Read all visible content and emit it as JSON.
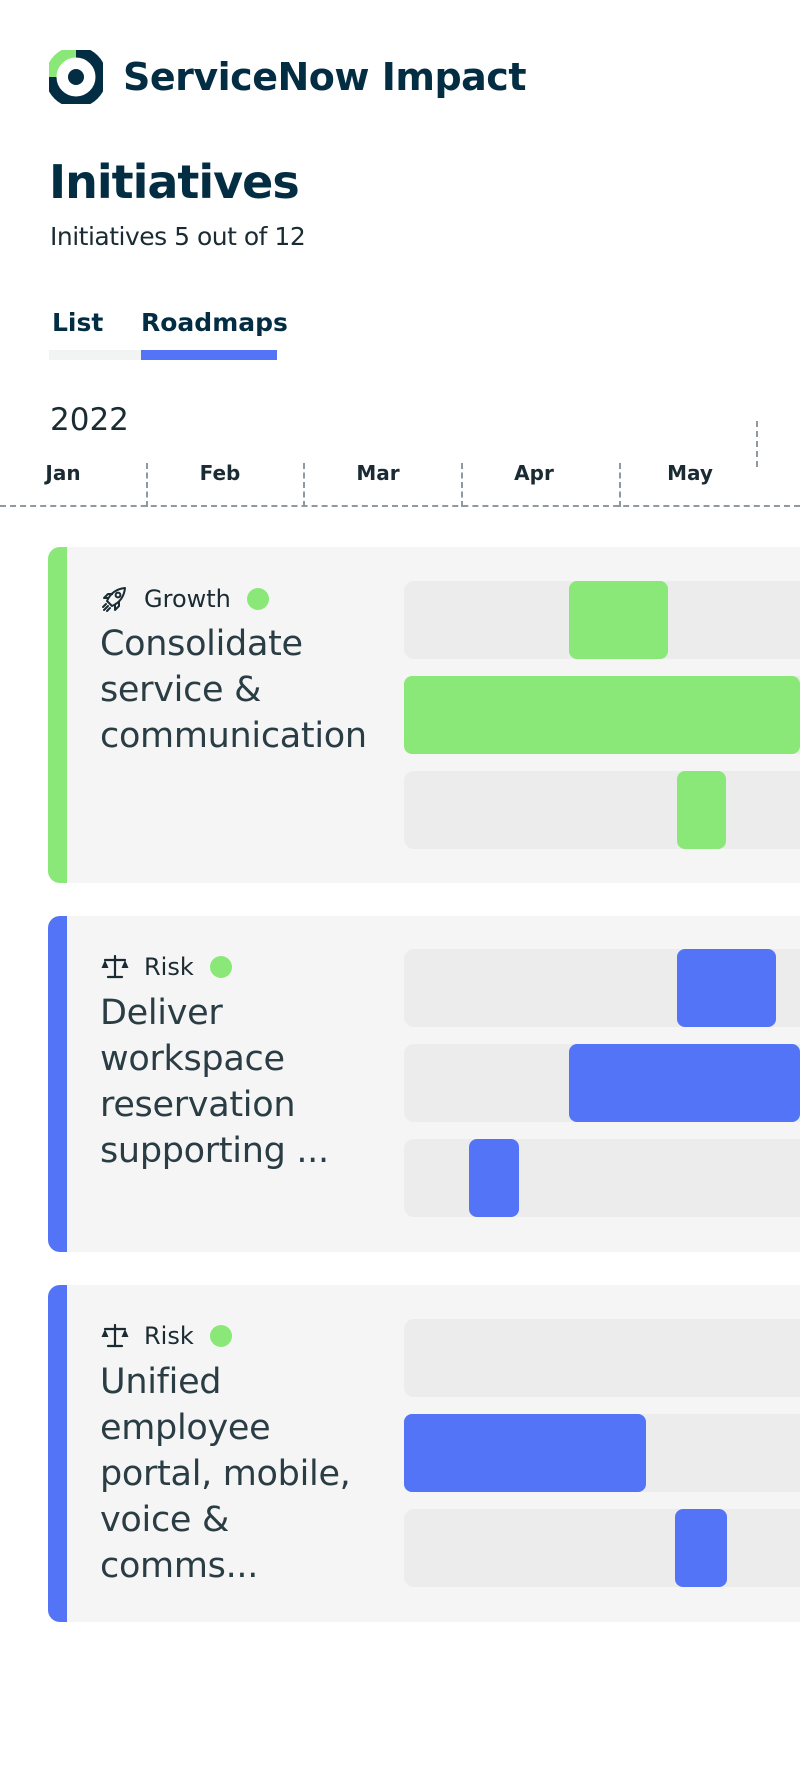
{
  "app": {
    "name": "ServiceNow Impact"
  },
  "page": {
    "title": "Initiatives",
    "subtitle": "Initiatives 5 out of 12"
  },
  "tabs": [
    {
      "label": "List",
      "active": false
    },
    {
      "label": "Roadmaps",
      "active": true
    }
  ],
  "timeline": {
    "year": "2022",
    "months": [
      "Jan",
      "Feb",
      "Mar",
      "Apr",
      "May"
    ]
  },
  "colors": {
    "brand_navy": "#032d42",
    "growth_green": "#8ae878",
    "risk_blue": "#5374f7",
    "card_bg": "#f5f5f5",
    "lane_bg": "#ececec",
    "status_green": "#8ae878"
  },
  "initiatives": [
    {
      "category": "Growth",
      "category_icon": "rocket-icon",
      "status": "green",
      "title": "Consolidate service & communication"
    },
    {
      "category": "Risk",
      "category_icon": "scale-icon",
      "status": "green",
      "title": "Deliver workspace reservation supporting ..."
    },
    {
      "category": "Risk",
      "category_icon": "scale-icon",
      "status": "green",
      "title": "Unified employee portal, mobile, voice & comms..."
    }
  ]
}
